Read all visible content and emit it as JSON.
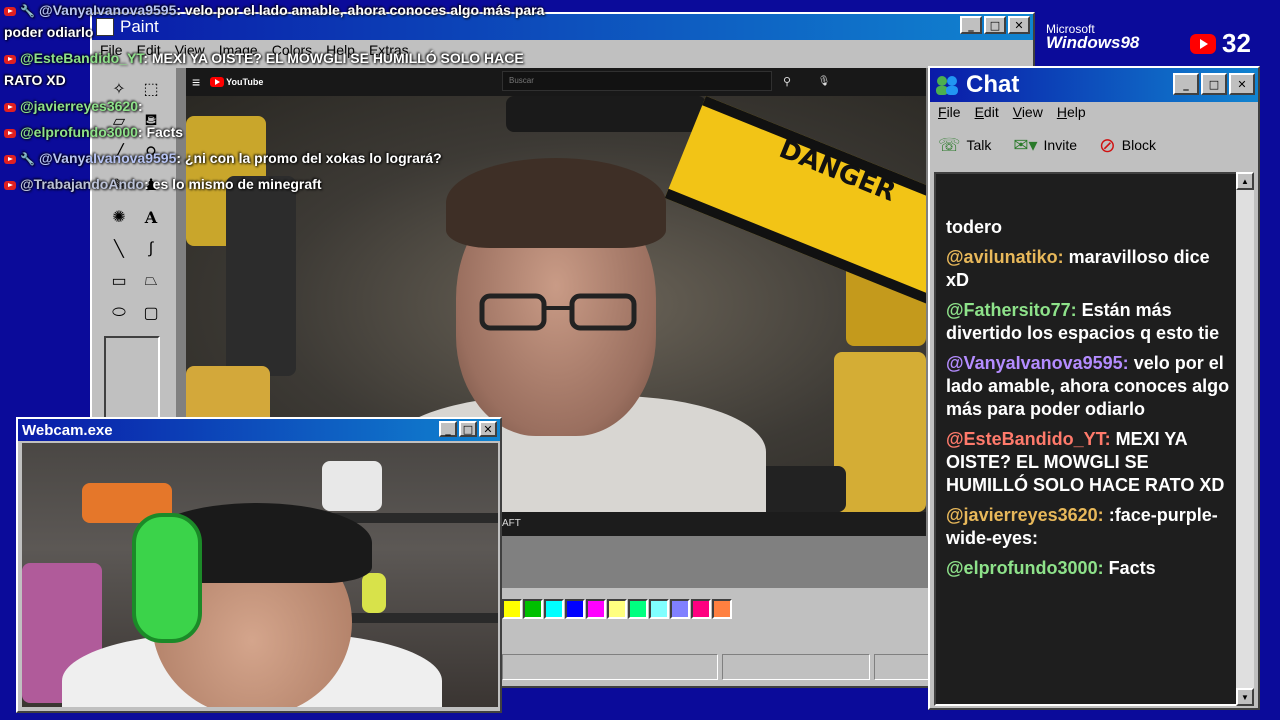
{
  "overlay": {
    "lines": [
      {
        "user": "@VanyaIvanova9595",
        "text": ": velo por el lado amable, ahora conoces algo más para"
      },
      {
        "cont": "poder odiarlo"
      },
      {
        "user": "@EsteBandido_YT",
        "text": ": MEXI YA OISTE? EL MOWGLI SE HUMILLÓ SOLO HACE"
      },
      {
        "cont": "RATO XD"
      },
      {
        "user": "@javierreyes3620",
        "text": ":"
      },
      {
        "user": "@elprofundo3000",
        "text": ": Facts"
      },
      {
        "user": "@VanyaIvanova9595",
        "text": ": ¿ni con la promo del xokas lo logrará?"
      },
      {
        "user": "@TrabajandoAndo",
        "text": ": es lo mismo de minegraft"
      }
    ]
  },
  "paint": {
    "title": "Paint",
    "menu": [
      "File",
      "Edit",
      "View",
      "Image",
      "Colors",
      "Help",
      "Extras"
    ],
    "palette": [
      "#ffff00",
      "#00c000",
      "#00ffff",
      "#0000ff",
      "#ff00ff",
      "#ffff80",
      "#00ff80",
      "#80ffff",
      "#8080ff",
      "#ff0080",
      "#ff8040"
    ]
  },
  "video": {
    "brand": "YouTube",
    "search_placeholder": "Buscar",
    "danger": "DANGER",
    "caption_fragment": "AFT"
  },
  "desktop": {
    "ms_label": "Microsoft",
    "windows_label": "Windows98",
    "viewer_count": "32"
  },
  "chat": {
    "title": "Chat",
    "menu": [
      "File",
      "Edit",
      "View",
      "Help"
    ],
    "tools": {
      "talk": "Talk",
      "invite": "Invite",
      "block": "Block"
    },
    "messages": [
      {
        "user": "",
        "text": "todero",
        "color": "#ffffff"
      },
      {
        "user": "@avilunatiko:",
        "text": "maravilloso dice xD",
        "color": "#e8b85a"
      },
      {
        "user": "@Fathersito77:",
        "text": "Están más divertido los espacios q esto tie",
        "color": "#8ee28a"
      },
      {
        "user": "@VanyaIvanova9595:",
        "text": "velo por el lado amable, ahora conoces algo más para poder odiarlo",
        "color": "#b48cff"
      },
      {
        "user": "@EsteBandido_YT:",
        "text": "MEXI YA OISTE? EL MOWGLI SE HUMILLÓ SOLO HACE RATO XD",
        "color": "#ff7a6b"
      },
      {
        "user": "@javierreyes3620:",
        "text": ":face-purple-wide-eyes:",
        "color": "#e8b85a"
      },
      {
        "user": "@elprofundo3000:",
        "text": "Facts",
        "color": "#8ee28a"
      }
    ]
  },
  "webcam": {
    "title": "Webcam.exe"
  }
}
